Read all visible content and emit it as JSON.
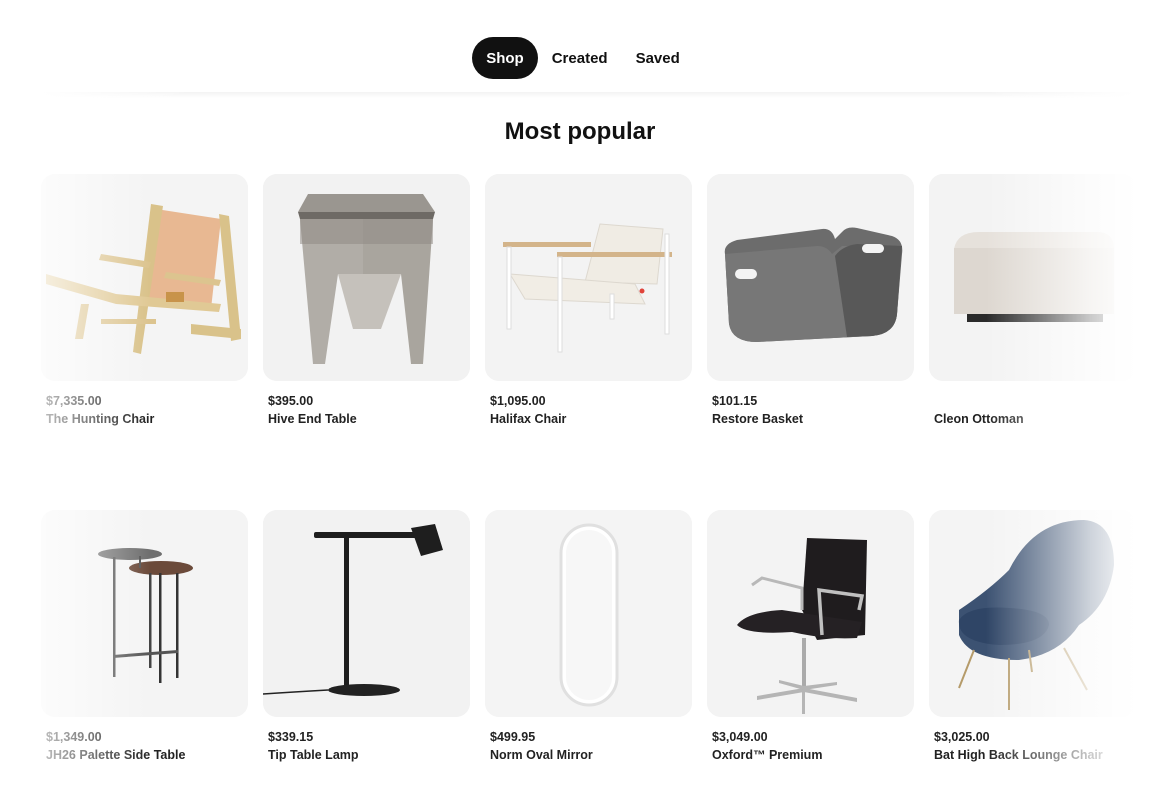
{
  "tabs": [
    {
      "label": "Shop",
      "active": true
    },
    {
      "label": "Created",
      "active": false
    },
    {
      "label": "Saved",
      "active": false
    }
  ],
  "section_title": "Most popular",
  "products": [
    {
      "price": "$7,335.00",
      "name": "The Hunting Chair",
      "image": "hunting-chair"
    },
    {
      "price": "$395.00",
      "name": "Hive End Table",
      "image": "hive-end-table"
    },
    {
      "price": "$1,095.00",
      "name": "Halifax Chair",
      "image": "halifax-chair"
    },
    {
      "price": "$101.15",
      "name": "Restore Basket",
      "image": "restore-basket"
    },
    {
      "price": "",
      "name": "Cleon Ottoman",
      "image": "cleon-ottoman"
    },
    {
      "price": "$1,349.00",
      "name": "JH26 Palette Side Table",
      "image": "palette-side-table"
    },
    {
      "price": "$339.15",
      "name": "Tip Table Lamp",
      "image": "tip-table-lamp"
    },
    {
      "price": "$499.95",
      "name": "Norm Oval Mirror",
      "image": "norm-oval-mirror"
    },
    {
      "price": "$3,049.00",
      "name": "Oxford™ Premium",
      "image": "oxford-chair"
    },
    {
      "price": "$3,025.00",
      "name": "Bat High Back Lounge Chair",
      "image": "bat-lounge-chair"
    }
  ],
  "colors": {
    "active_tab_bg": "#111111",
    "card_bg": "#f2f2f2"
  }
}
